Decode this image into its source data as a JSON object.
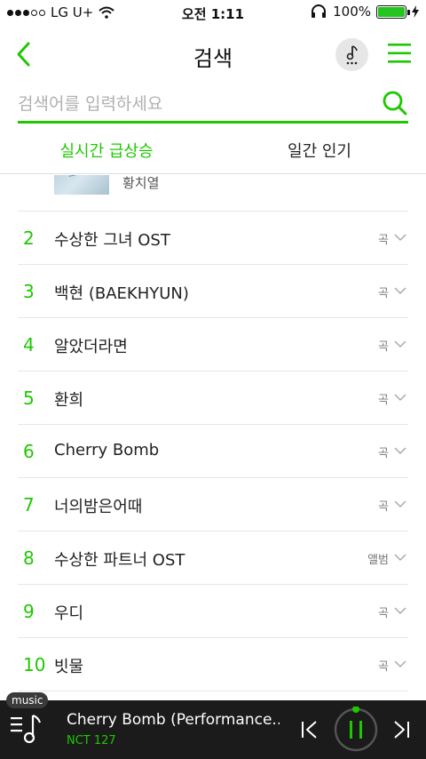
{
  "status_bar": {
    "carrier": "LG U+",
    "time": "오전 1:11",
    "battery": "100%"
  },
  "header": {
    "title": "검색"
  },
  "search": {
    "placeholder": "검색어를 입력하세요",
    "value": ""
  },
  "tabs": [
    {
      "label": "실시간 급상승",
      "active": true
    },
    {
      "label": "일간 인기",
      "active": false
    }
  ],
  "first_item": {
    "artist": "황치열"
  },
  "ranking": [
    {
      "rank": "2",
      "title": "수상한 그녀 OST",
      "type": "곡"
    },
    {
      "rank": "3",
      "title": "백현 (BAEKHYUN)",
      "type": "곡"
    },
    {
      "rank": "4",
      "title": "알았더라면",
      "type": "곡"
    },
    {
      "rank": "5",
      "title": "환희",
      "type": "곡"
    },
    {
      "rank": "6",
      "title": "Cherry Bomb",
      "type": "곡"
    },
    {
      "rank": "7",
      "title": "너의밤은어때",
      "type": "곡"
    },
    {
      "rank": "8",
      "title": "수상한 파트너 OST",
      "type": "앨범"
    },
    {
      "rank": "9",
      "title": "우디",
      "type": "곡"
    },
    {
      "rank": "10",
      "title": "빗물",
      "type": "곡"
    }
  ],
  "player": {
    "badge": "music",
    "song_title": "Cherry Bomb (Performance...",
    "artist": "NCT 127"
  },
  "colors": {
    "accent": "#1ec800",
    "player_bg": "#1b1b1b",
    "divider": "#e6e6e6"
  }
}
